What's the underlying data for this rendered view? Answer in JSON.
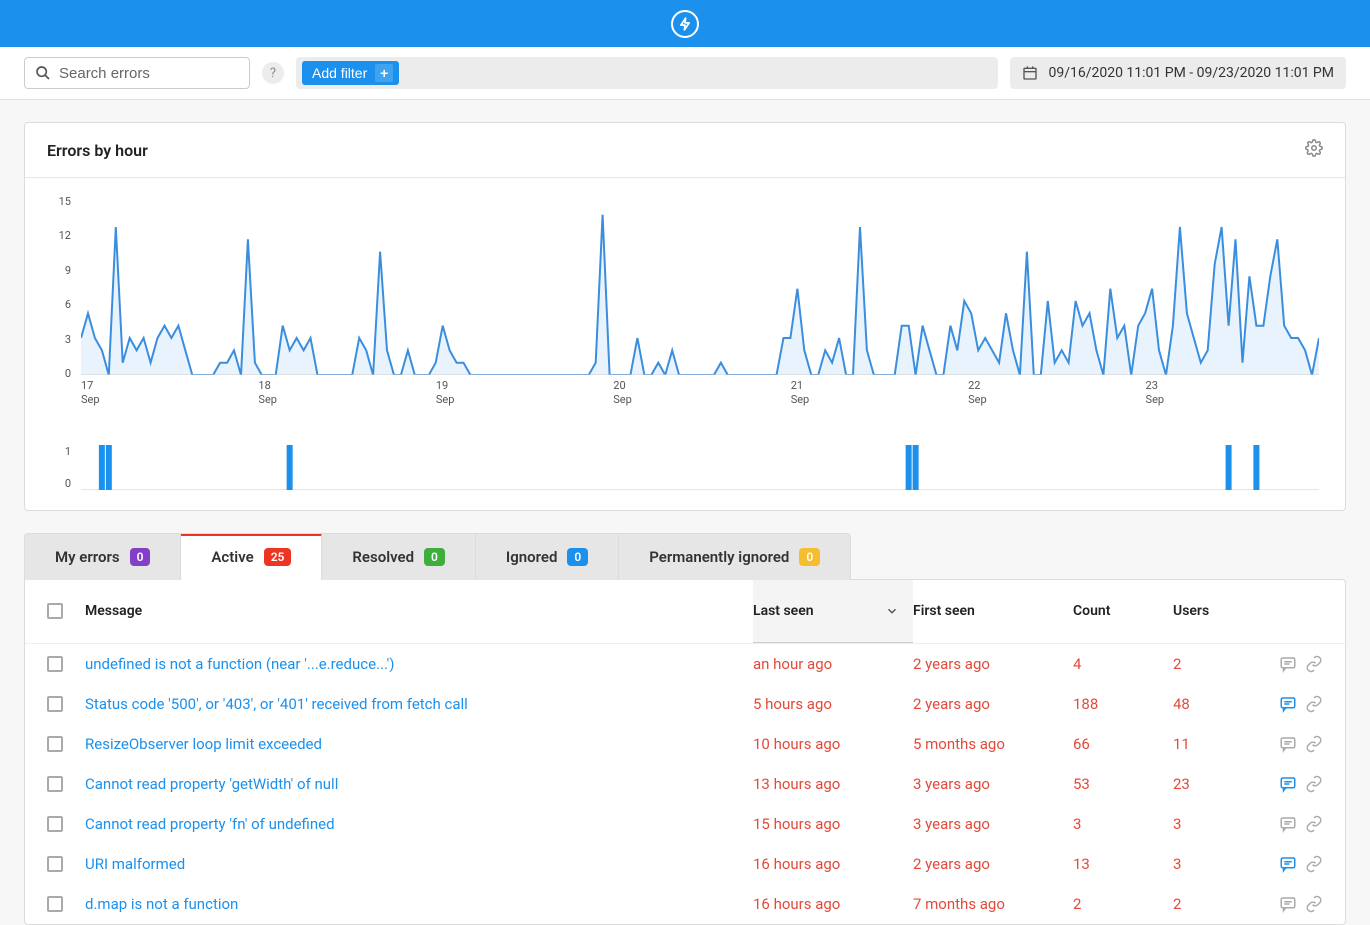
{
  "toolbar": {
    "search_placeholder": "Search errors",
    "help_label": "?",
    "add_filter_label": "Add filter",
    "date_range": "09/16/2020 11:01 PM - 09/23/2020 11:01 PM"
  },
  "chart": {
    "title": "Errors by hour"
  },
  "chart_data": {
    "type": "line",
    "title": "Errors by hour",
    "ylabel": "",
    "xlabel": "",
    "ylim": [
      0,
      15
    ],
    "yticks": [
      0,
      3,
      6,
      9,
      12,
      15
    ],
    "xticks": [
      "17 Sep",
      "18 Sep",
      "19 Sep",
      "20 Sep",
      "21 Sep",
      "22 Sep",
      "23 Sep"
    ],
    "values": [
      3,
      5,
      3,
      2,
      0,
      12,
      1,
      3,
      2,
      3,
      1,
      3,
      4,
      3,
      4,
      2,
      0,
      0,
      0,
      0,
      1,
      1,
      2,
      0,
      11,
      1,
      0,
      0,
      0,
      4,
      2,
      3,
      2,
      3,
      0,
      0,
      0,
      0,
      0,
      0,
      3,
      2,
      0,
      10,
      2,
      0,
      0,
      2,
      0,
      0,
      0,
      1,
      4,
      2,
      1,
      1,
      0,
      0,
      0,
      0,
      0,
      0,
      0,
      0,
      0,
      0,
      0,
      0,
      0,
      0,
      0,
      0,
      0,
      0,
      1,
      13,
      0,
      0,
      0,
      0,
      3,
      0,
      0,
      1,
      0,
      2,
      0,
      0,
      0,
      0,
      0,
      0,
      1,
      0,
      0,
      0,
      0,
      0,
      0,
      0,
      0,
      3,
      3,
      7,
      2,
      0,
      0,
      2,
      1,
      3,
      0,
      0,
      12,
      2,
      0,
      0,
      0,
      0,
      4,
      4,
      0,
      4,
      2,
      0,
      0,
      4,
      2,
      6,
      5,
      2,
      3,
      2,
      1,
      5,
      2,
      0,
      10,
      0,
      0,
      6,
      1,
      2,
      1,
      6,
      4,
      5,
      2,
      0,
      7,
      3,
      4,
      0,
      4,
      5,
      7,
      2,
      0,
      4,
      12,
      5,
      3,
      1,
      2,
      9,
      12,
      4,
      11,
      1,
      8,
      4,
      4,
      8,
      11,
      4,
      3,
      3,
      2,
      0,
      3
    ]
  },
  "chart_data2": {
    "type": "bar",
    "ylim": [
      0,
      1
    ],
    "yticks": [
      0,
      1
    ],
    "bars": [
      {
        "x": 3,
        "value": 1
      },
      {
        "x": 4,
        "value": 1
      },
      {
        "x": 30,
        "value": 1
      },
      {
        "x": 119,
        "value": 1
      },
      {
        "x": 120,
        "value": 1
      },
      {
        "x": 165,
        "value": 1
      },
      {
        "x": 169,
        "value": 1
      }
    ],
    "x_count": 179
  },
  "tabs": [
    {
      "label": "My errors",
      "count": "0",
      "badge_class": "bg-purple"
    },
    {
      "label": "Active",
      "count": "25",
      "badge_class": "bg-red",
      "active": true
    },
    {
      "label": "Resolved",
      "count": "0",
      "badge_class": "bg-green"
    },
    {
      "label": "Ignored",
      "count": "0",
      "badge_class": "bg-blue"
    },
    {
      "label": "Permanently ignored",
      "count": "0",
      "badge_class": "bg-yellow"
    }
  ],
  "table": {
    "headers": {
      "message": "Message",
      "last_seen": "Last seen",
      "first_seen": "First seen",
      "count": "Count",
      "users": "Users"
    },
    "rows": [
      {
        "msg": "undefined is not a function (near '...e.reduce...')",
        "last": "an hour ago",
        "first": "2 years ago",
        "count": "4",
        "users": "2",
        "comment_active": false
      },
      {
        "msg": "Status code '500', or '403', or '401' received from fetch call",
        "last": "5 hours ago",
        "first": "2 years ago",
        "count": "188",
        "users": "48",
        "comment_active": true
      },
      {
        "msg": "ResizeObserver loop limit exceeded",
        "last": "10 hours ago",
        "first": "5 months ago",
        "count": "66",
        "users": "11",
        "comment_active": false
      },
      {
        "msg": "Cannot read property 'getWidth' of null",
        "last": "13 hours ago",
        "first": "3 years ago",
        "count": "53",
        "users": "23",
        "comment_active": true
      },
      {
        "msg": "Cannot read property 'fn' of undefined",
        "last": "15 hours ago",
        "first": "3 years ago",
        "count": "3",
        "users": "3",
        "comment_active": false
      },
      {
        "msg": "URI malformed",
        "last": "16 hours ago",
        "first": "2 years ago",
        "count": "13",
        "users": "3",
        "comment_active": true
      },
      {
        "msg": "d.map is not a function",
        "last": "16 hours ago",
        "first": "7 months ago",
        "count": "2",
        "users": "2",
        "comment_active": false
      }
    ]
  }
}
